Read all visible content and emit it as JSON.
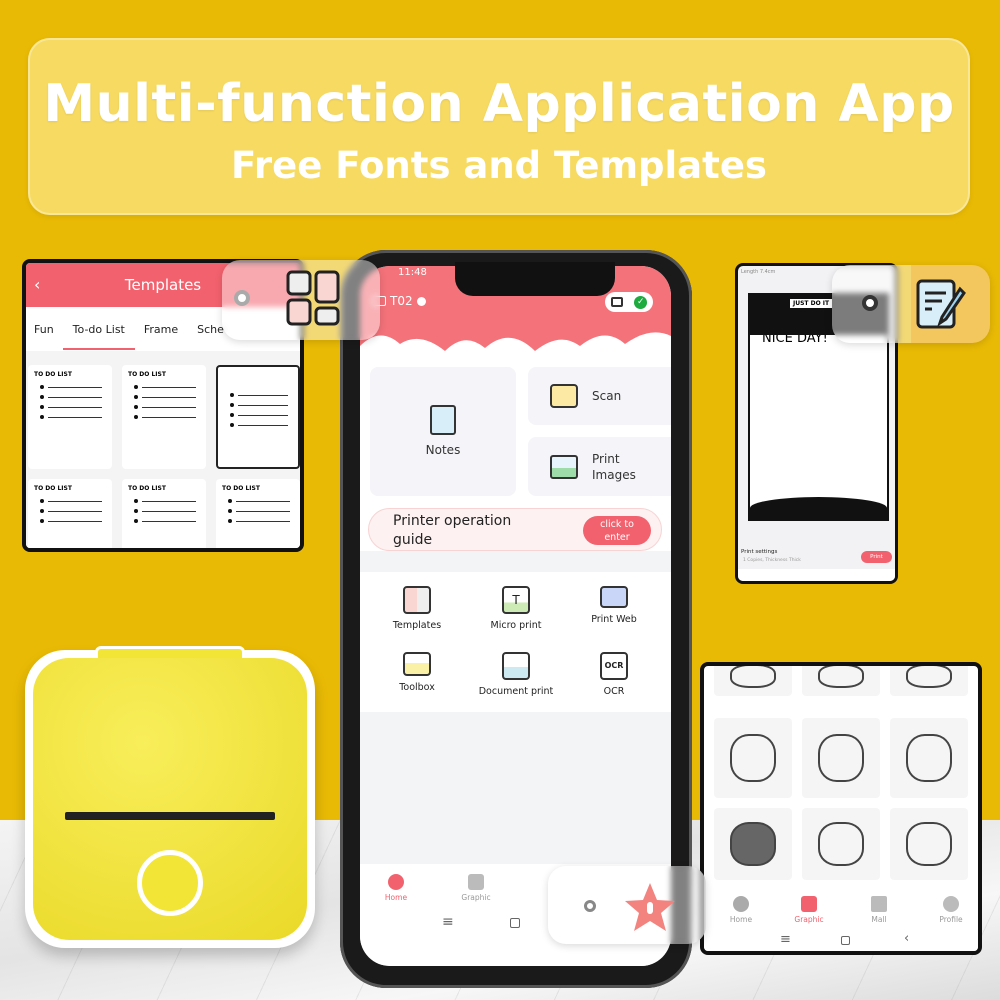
{
  "banner": {
    "title": "Multi-function Application App",
    "subtitle": "Free Fonts and Templates"
  },
  "templates_screen": {
    "title": "Templates",
    "back_icon": "chevron-left",
    "tabs": [
      "Fun",
      "To-do List",
      "Frame",
      "Sche"
    ],
    "active_tab": "To-do List",
    "cards": [
      "TO DO LIST",
      "TO DO LIST",
      "",
      "TO DO LIST",
      "TO DO LIST",
      "TO DO LIST"
    ]
  },
  "main_phone": {
    "time": "11:48",
    "device": "T02",
    "features_top": {
      "notes": "Notes",
      "scan": "Scan",
      "print_images": "Print Images"
    },
    "guide": {
      "label": "Printer operation guide",
      "button": "click to enter"
    },
    "features": [
      "Templates",
      "Micro print",
      "Print Web",
      "Toolbox",
      "Document print",
      "OCR"
    ],
    "nav": [
      "Home",
      "Graphic"
    ],
    "active_nav": "Home"
  },
  "editor_screen": {
    "length": "Length 7.4cm",
    "headline": "NICE DAY!",
    "badge": "JUST DO IT",
    "print_settings": "Print settings",
    "settings_detail": "1 Copies, Thickness Thick",
    "print_button": "Print"
  },
  "graphic_screen": {
    "nav": [
      "Home",
      "Graphic",
      "Mall",
      "Profile"
    ],
    "active_nav": "Graphic"
  },
  "colors": {
    "background": "#E9BA05",
    "accent": "#F2626E",
    "printer": "#F2E535"
  }
}
